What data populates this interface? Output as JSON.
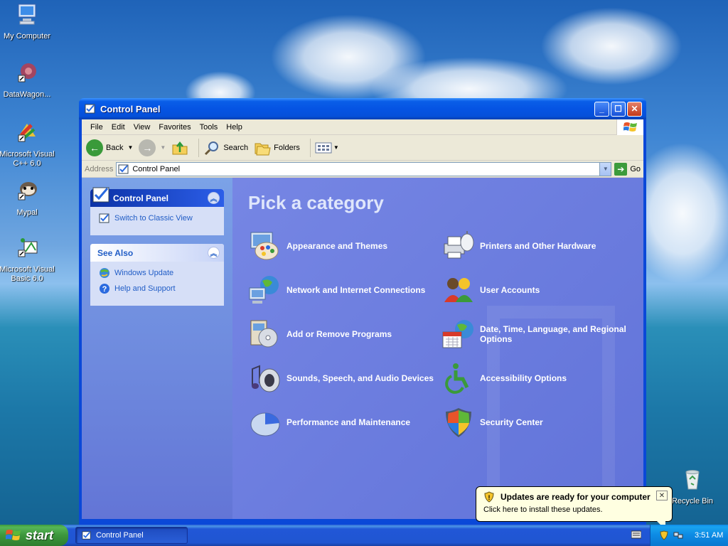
{
  "desktop": {
    "icons": [
      {
        "label": "My Computer"
      },
      {
        "label": "DataWagon..."
      },
      {
        "label": "Microsoft Visual C++ 6.0"
      },
      {
        "label": "Mypal"
      },
      {
        "label": "Microsoft Visual Basic 6.0"
      },
      {
        "label": "Recycle Bin"
      }
    ]
  },
  "window": {
    "title": "Control Panel",
    "menu": [
      "File",
      "Edit",
      "View",
      "Favorites",
      "Tools",
      "Help"
    ],
    "toolbar": {
      "back": "Back",
      "search": "Search",
      "folders": "Folders"
    },
    "address": {
      "label": "Address",
      "value": "Control Panel",
      "go": "Go"
    },
    "sidebar": {
      "control_panel": {
        "title": "Control Panel",
        "links": [
          "Switch to Classic View"
        ]
      },
      "see_also": {
        "title": "See Also",
        "links": [
          "Windows Update",
          "Help and Support"
        ]
      }
    },
    "main": {
      "heading": "Pick a category",
      "categories": [
        {
          "label": "Appearance and Themes",
          "icon": "appearance-icon"
        },
        {
          "label": "Printers and Other Hardware",
          "icon": "printer-icon"
        },
        {
          "label": "Network and Internet Connections",
          "icon": "network-icon"
        },
        {
          "label": "User Accounts",
          "icon": "users-icon"
        },
        {
          "label": "Add or Remove Programs",
          "icon": "programs-icon"
        },
        {
          "label": "Date, Time, Language, and Regional Options",
          "icon": "datetime-icon"
        },
        {
          "label": "Sounds, Speech, and Audio Devices",
          "icon": "sound-icon"
        },
        {
          "label": "Accessibility Options",
          "icon": "accessibility-icon"
        },
        {
          "label": "Performance and Maintenance",
          "icon": "performance-icon"
        },
        {
          "label": "Security Center",
          "icon": "shield-icon"
        }
      ]
    }
  },
  "balloon": {
    "title": "Updates are ready for your computer",
    "body": "Click here to install these updates.",
    "close": "✕"
  },
  "taskbar": {
    "start": "start",
    "item": "Control Panel",
    "clock": "3:51 AM"
  },
  "colors": {
    "accent": "#0a48d8",
    "sidebar": "#7ba2e7",
    "main": "#6b7de2",
    "start_green": "#3c963c"
  }
}
